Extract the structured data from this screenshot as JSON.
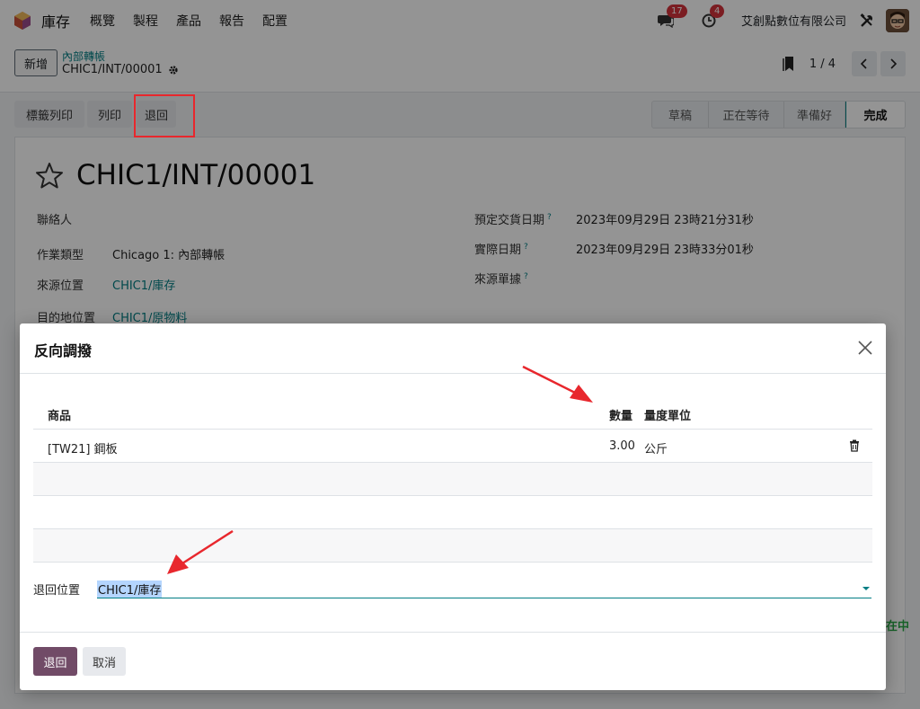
{
  "nav": {
    "app_name": "庫存",
    "menu": [
      "概覽",
      "製程",
      "產品",
      "報告",
      "配置"
    ],
    "messages_count": "17",
    "activities_count": "4",
    "company": "艾創點數位有限公司"
  },
  "control": {
    "new_label": "新增",
    "breadcrumb": "內部轉帳",
    "record_name": "CHIC1/INT/00001",
    "pager_value": "1 / 4"
  },
  "actions": {
    "print_labels": "標籤列印",
    "print": "列印",
    "return": "退回"
  },
  "status": {
    "stages": [
      "草稿",
      "正在等待",
      "準備好",
      "完成"
    ],
    "current": "完成"
  },
  "form": {
    "title": "CHIC1/INT/00001",
    "contact_label": "聯絡人",
    "operation_type_label": "作業類型",
    "operation_type_value": "Chicago 1: 內部轉帳",
    "source_location_label": "來源位置",
    "source_location_value": "CHIC1/庫存",
    "dest_location_label": "目的地位置",
    "dest_location_value": "CHIC1/原物料",
    "scheduled_date_label": "預定交貨日期",
    "scheduled_date_value": "2023年09月29日 23時21分31秒",
    "effective_date_label": "實際日期",
    "effective_date_value": "2023年09月29日 23時33分01秒",
    "source_doc_label": "來源單據",
    "help_mark": "?"
  },
  "background_peek": "在中",
  "modal": {
    "title": "反向調撥",
    "columns": {
      "product": "商品",
      "quantity": "數量",
      "uom": "量度單位"
    },
    "rows": [
      {
        "product": "[TW21] 鋼板",
        "quantity": "3.00",
        "uom": "公斤"
      }
    ],
    "return_location_label": "退回位置",
    "return_location_value": "CHIC1/庫存",
    "confirm_label": "退回",
    "cancel_label": "取消"
  },
  "colors": {
    "brand": "#714b67",
    "link": "#017e84",
    "annotation": "#e8272d",
    "badge": "#d4333b"
  }
}
